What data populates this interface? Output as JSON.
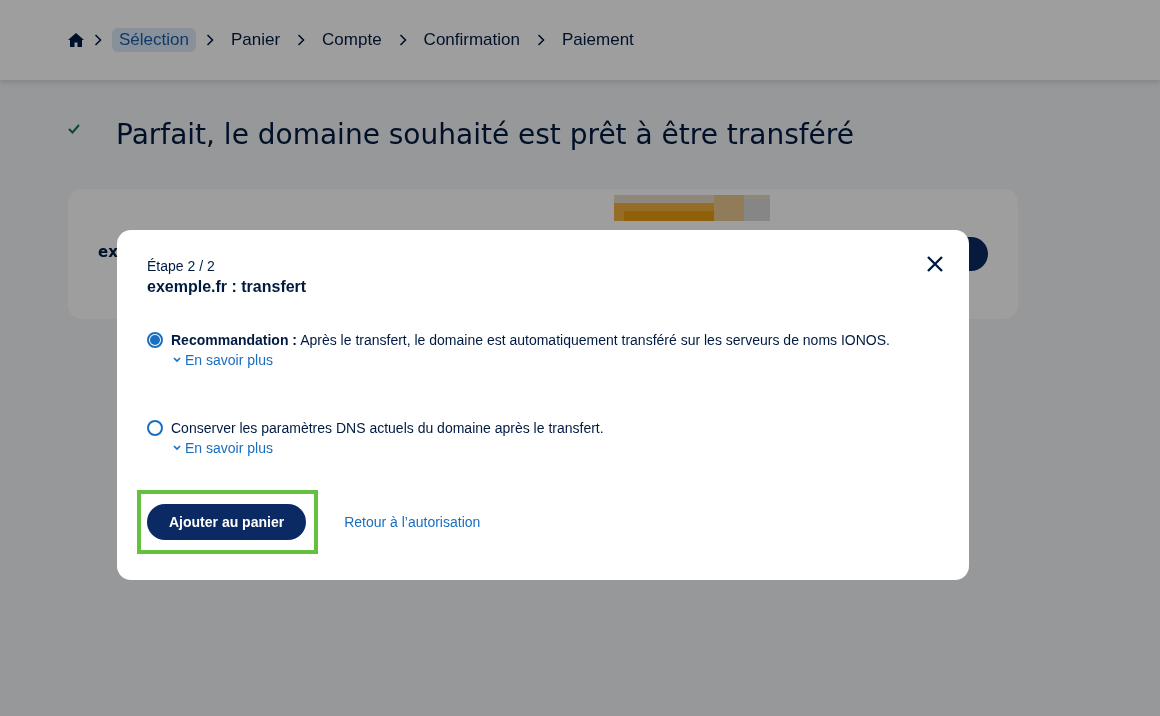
{
  "breadcrumb": [
    {
      "label": "Sélection",
      "selected": true
    },
    {
      "label": "Panier",
      "selected": false
    },
    {
      "label": "Compte",
      "selected": false
    },
    {
      "label": "Confirmation",
      "selected": false
    },
    {
      "label": "Paiement",
      "selected": false
    }
  ],
  "title": "Parfait, le domaine souhaité est prêt à être transféré",
  "card": {
    "text": "ex"
  },
  "dialog": {
    "step": "Étape 2 / 2",
    "heading": "exemple.fr : transfert",
    "options": [
      {
        "text": "**Recommandation :** Après le transfert, le domaine est automatiquement transféré sur les serveurs de noms IONOS.",
        "selected": true,
        "more": "En savoir plus"
      },
      {
        "text": "Conserver les paramètres DNS actuels du domaine après le transfert.",
        "selected": false,
        "more": "En savoir plus"
      }
    ],
    "primary_button": {
      "label": "Ajouter au panier",
      "highlighted": true
    },
    "secondary_link": "Retour à l’autorisation"
  }
}
